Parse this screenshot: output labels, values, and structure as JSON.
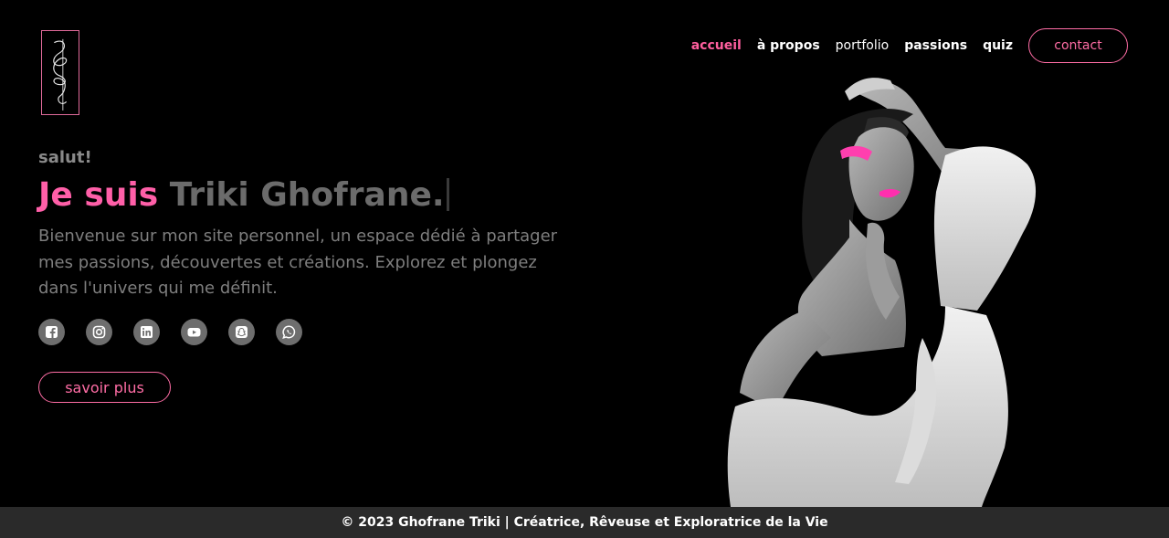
{
  "nav": {
    "items": [
      {
        "label": "accueil",
        "active": true
      },
      {
        "label": "à propos",
        "active": false
      },
      {
        "label": "portfolio",
        "active": false
      },
      {
        "label": "passions",
        "active": false
      },
      {
        "label": "quiz",
        "active": false
      }
    ],
    "contact_label": "contact"
  },
  "hero": {
    "greeting": "salut!",
    "headline_prefix": "Je suis",
    "headline_name": "Triki Ghofrane.",
    "intro": "Bienvenue sur mon site personnel, un espace dédié à partager mes passions, découvertes et créations. Explorez et plongez dans l'univers qui me définit.",
    "more_label": "savoir plus"
  },
  "socials": [
    {
      "icon": "facebook-icon"
    },
    {
      "icon": "instagram-icon"
    },
    {
      "icon": "linkedin-icon"
    },
    {
      "icon": "youtube-icon"
    },
    {
      "icon": "snapchat-icon"
    },
    {
      "icon": "whatsapp-icon"
    }
  ],
  "footer": {
    "text": "© 2023 Ghofrane Triki | Créatrice, Rêveuse et Exploratrice de la Vie"
  },
  "colors": {
    "accent": "#ff5fa8",
    "background": "#000000",
    "footer_bg": "#2a2a2a"
  }
}
